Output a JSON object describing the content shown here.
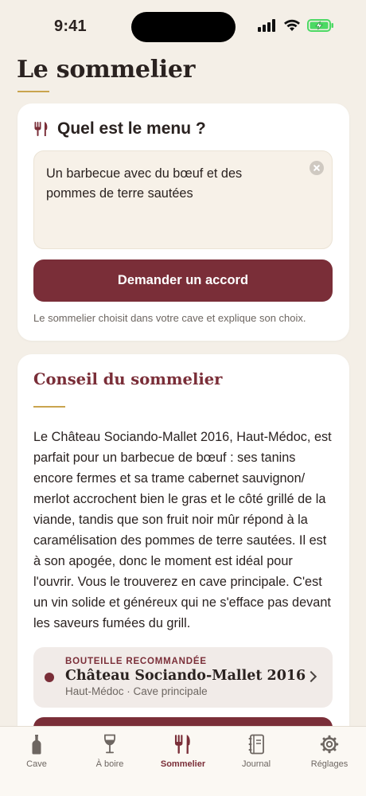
{
  "status_bar": {
    "time": "9:41"
  },
  "header": {
    "title": "Le sommelier"
  },
  "menu_card": {
    "heading": "Quel est le menu ?",
    "input_value": "Un barbecue avec du bœuf et des pommes de terre sautées",
    "button_label": "Demander un accord",
    "hint": "Le sommelier choisit dans votre cave et explique son choix."
  },
  "advice_card": {
    "title": "Conseil du sommelier",
    "text": "Le Château Sociando-Mallet 2016, Haut-Médoc, est parfait pour un barbecue de bœuf : ses tanins encore fermes et sa trame cabernet sauvignon/ merlot accrochent bien le gras et le côté grillé de la viande, tandis que son fruit noir mûr répond à la caramélisation des pommes de terre sautées. Il est à son apogée, donc le moment est idéal pour l'ouvrir. Vous le trouverez en cave principale. C'est un vin solide et généreux qui ne s'efface pas devant les saveurs fumées du grill.",
    "bottle": {
      "eyebrow": "BOUTEILLE RECOMMANDÉE",
      "name": "Château Sociando-Mallet 2016",
      "meta": "Haut-Médoc · Cave principale"
    }
  },
  "tab_bar": {
    "tabs": [
      {
        "label": "Cave",
        "icon": "bottle-icon"
      },
      {
        "label": "À boire",
        "icon": "wine-glass-icon"
      },
      {
        "label": "Sommelier",
        "icon": "fork-knife-icon"
      },
      {
        "label": "Journal",
        "icon": "journal-icon"
      },
      {
        "label": "Réglages",
        "icon": "gear-icon"
      }
    ],
    "active_index": 2
  },
  "colors": {
    "accent": "#7a2e38",
    "gold": "#c9a44e",
    "background": "#f4efe7",
    "battery": "#4cd964"
  }
}
